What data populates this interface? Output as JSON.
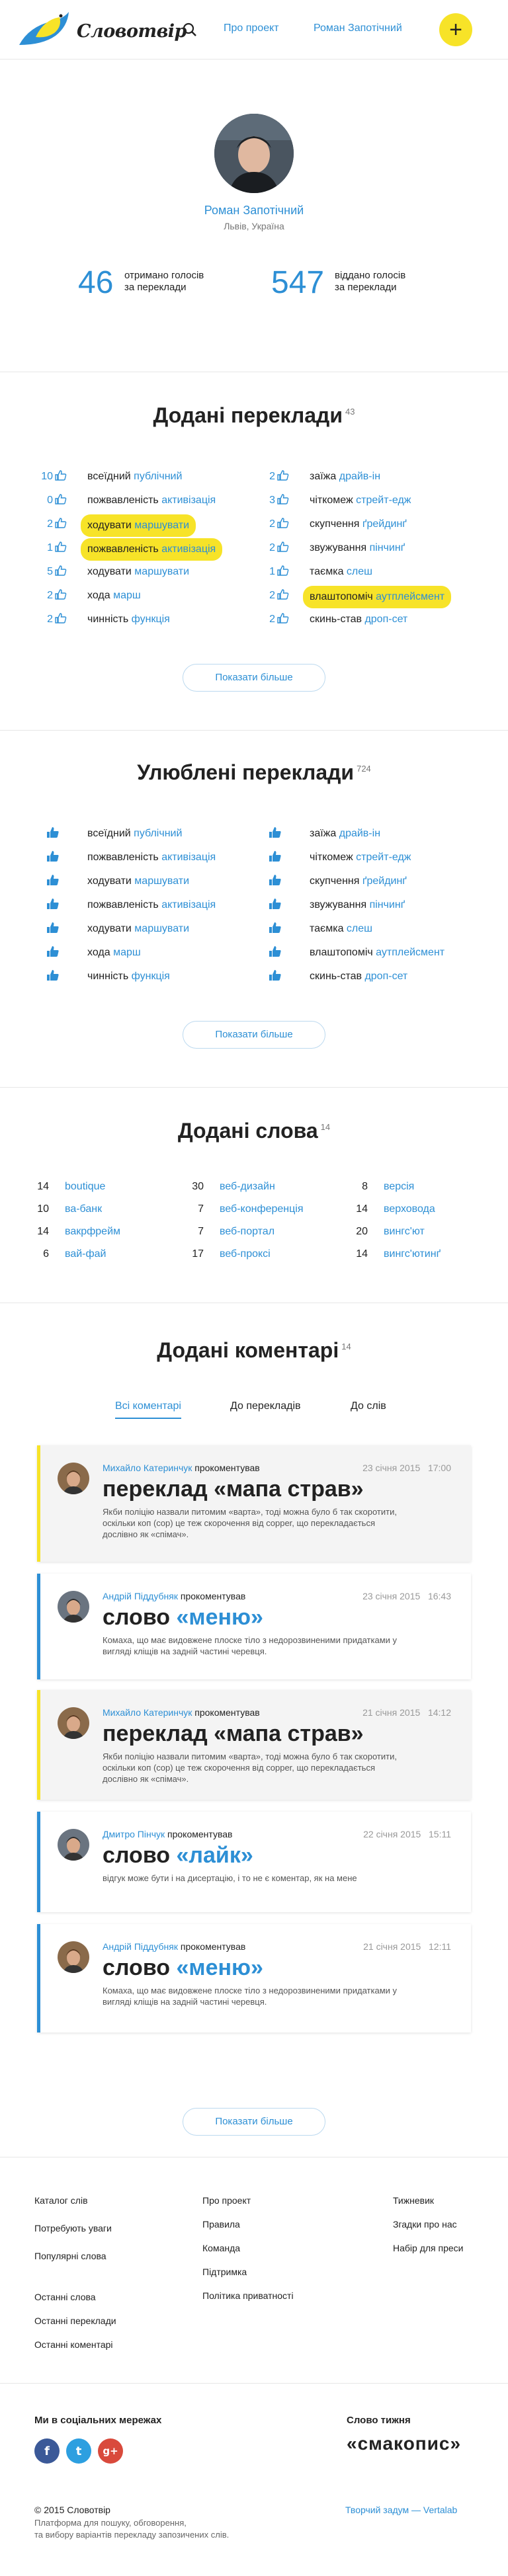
{
  "header": {
    "logo_text": "Словотвір",
    "nav": [
      "Про проект",
      "Роман Запотічний"
    ],
    "add_button": "+"
  },
  "profile": {
    "name": "Роман Запотічний",
    "location": "Львів, Україна",
    "stats": [
      {
        "value": "46",
        "label1": "отримано голосів",
        "label2": "за переклади"
      },
      {
        "value": "547",
        "label1": "віддано голосів",
        "label2": "за переклади"
      }
    ]
  },
  "added_translations": {
    "title": "Додані переклади",
    "count": "43",
    "left": [
      {
        "count": "10",
        "word": "всеїдний",
        "translation": "публічний",
        "hl": false
      },
      {
        "count": "0",
        "word": "пожвавленість",
        "translation": "активізація",
        "hl": false
      },
      {
        "count": "2",
        "word": "ходувати",
        "translation": "маршувати",
        "hl": true
      },
      {
        "count": "1",
        "word": "пожвавленість",
        "translation": "активізація",
        "hl": true
      },
      {
        "count": "5",
        "word": "ходувати",
        "translation": "маршувати",
        "hl": false
      },
      {
        "count": "2",
        "word": "хода",
        "translation": "марш",
        "hl": false
      },
      {
        "count": "2",
        "word": "чинність",
        "translation": "функція",
        "hl": false
      }
    ],
    "right": [
      {
        "count": "2",
        "word": "заїжа",
        "translation": "драйв-ін",
        "hl": false
      },
      {
        "count": "3",
        "word": "чіткомеж",
        "translation": "стрейт-едж",
        "hl": false
      },
      {
        "count": "2",
        "word": "скупчення",
        "translation": "ґрейдинґ",
        "hl": false
      },
      {
        "count": "2",
        "word": "звужування",
        "translation": "пінчинґ",
        "hl": false
      },
      {
        "count": "1",
        "word": "таємка",
        "translation": "слеш",
        "hl": false
      },
      {
        "count": "2",
        "word": "влаштопоміч",
        "translation": "аутплейсмент",
        "hl": true
      },
      {
        "count": "2",
        "word": "скинь-став",
        "translation": "дроп-сет",
        "hl": false
      }
    ],
    "more": "Показати більше"
  },
  "favorite_translations": {
    "title": "Улюблені переклади",
    "count": "724",
    "left": [
      {
        "word": "всеїдний",
        "translation": "публічний"
      },
      {
        "word": "пожвавленість",
        "translation": "активізація"
      },
      {
        "word": "ходувати",
        "translation": "маршувати"
      },
      {
        "word": "пожвавленість",
        "translation": "активізація"
      },
      {
        "word": "ходувати",
        "translation": "маршувати"
      },
      {
        "word": "хода",
        "translation": "марш"
      },
      {
        "word": "чинність",
        "translation": "функція"
      }
    ],
    "right": [
      {
        "word": "заїжа",
        "translation": "драйв-ін"
      },
      {
        "word": "чіткомеж",
        "translation": "стрейт-едж"
      },
      {
        "word": "скупчення",
        "translation": "ґрейдинґ"
      },
      {
        "word": "звужування",
        "translation": "пінчинґ"
      },
      {
        "word": "таємка",
        "translation": "слеш"
      },
      {
        "word": "влаштопоміч",
        "translation": "аутплейсмент"
      },
      {
        "word": "скинь-став",
        "translation": "дроп-сет"
      }
    ],
    "more": "Показати більше"
  },
  "added_words": {
    "title": "Додані слова",
    "count": "14",
    "cols": [
      [
        {
          "n": "14",
          "w": "boutique"
        },
        {
          "n": "10",
          "w": "ва-банк"
        },
        {
          "n": "14",
          "w": "вакрфрейм"
        },
        {
          "n": "6",
          "w": "вай-фай"
        }
      ],
      [
        {
          "n": "30",
          "w": "веб-дизайн"
        },
        {
          "n": "7",
          "w": "веб-конференція"
        },
        {
          "n": "7",
          "w": "веб-портал"
        },
        {
          "n": "17",
          "w": "веб-проксі"
        }
      ],
      [
        {
          "n": "8",
          "w": "версія"
        },
        {
          "n": "14",
          "w": "верховода"
        },
        {
          "n": "20",
          "w": "вингс'ют"
        },
        {
          "n": "14",
          "w": "вингс'ютинґ"
        }
      ]
    ]
  },
  "added_comments": {
    "title": "Додані коментарі",
    "count": "14",
    "tabs": [
      "Всі коментарі",
      "До перекладів",
      "До слів"
    ],
    "verb": "прокоментував",
    "items": [
      {
        "author": "Михайло Катеринчук",
        "date": "23 січня 2015",
        "time": "17:00",
        "prefix": "переклад",
        "subject": "«мапа страв»",
        "subject_blue": false,
        "body": "Якби поліцію назвали питомим «варта», тоді можна було б так скоротити, оскільки коп (cop) це теж скорочення від copper, що перекладається дослівно як «спімач».",
        "featured": true
      },
      {
        "author": "Андрій Піддубняк",
        "date": "23 січня 2015",
        "time": "16:43",
        "prefix": "слово",
        "subject": "«меню»",
        "subject_blue": true,
        "body": "Комаха, що має видовжене плоске тіло з недорозвиненими придатками у вигляді кліщів на задній частині черевця.",
        "featured": false
      },
      {
        "author": "Михайло Катеринчук",
        "date": "21 січня 2015",
        "time": "14:12",
        "prefix": "переклад",
        "subject": "«мапа страв»",
        "subject_blue": false,
        "body": "Якби поліцію назвали питомим «варта», тоді можна було б так скоротити, оскільки коп (cop) це теж скорочення від copper, що перекладається дослівно як «спімач».",
        "featured": true
      },
      {
        "author": "Дмитро Пінчук",
        "date": "22 січня 2015",
        "time": "15:11",
        "prefix": "слово",
        "subject": "«лайк»",
        "subject_blue": true,
        "body": "відгук може бути і на дисертацію, і то не є коментар, як на мене",
        "featured": false
      },
      {
        "author": "Андрій Піддубняк",
        "date": "21 січня 2015",
        "time": "12:11",
        "prefix": "слово",
        "subject": "«меню»",
        "subject_blue": true,
        "body": "Комаха, що має видовжене плоске тіло з недорозвиненими придатками у вигляді кліщів на задній частині черевця.",
        "featured": false
      }
    ],
    "more": "Показати більше"
  },
  "footer": {
    "col1": [
      "Каталог слів",
      "Потребують уваги",
      "Популярні слова"
    ],
    "col1b": [
      "Останні слова",
      "Останні переклади",
      "Останні коментарі"
    ],
    "col2": [
      "Про проект",
      "Правила",
      "Команда",
      "Підтримка",
      "Політика приватності"
    ],
    "col3": [
      "Тижневик",
      "Згадки про нас",
      "Набір для преси"
    ],
    "social_title": "Ми в соціальних мережах",
    "social": [
      "f",
      "t",
      "g+"
    ],
    "partner_title": "Слово тижня",
    "partner_word": "«смакопис»",
    "copyright": "© 2015 Словотвір",
    "tagline1": "Платформа для пошуку, обговорення,",
    "tagline2": "та вибору варіантів перекладу запозичених слів.",
    "credit": "Творчий задум — Vertalab"
  }
}
